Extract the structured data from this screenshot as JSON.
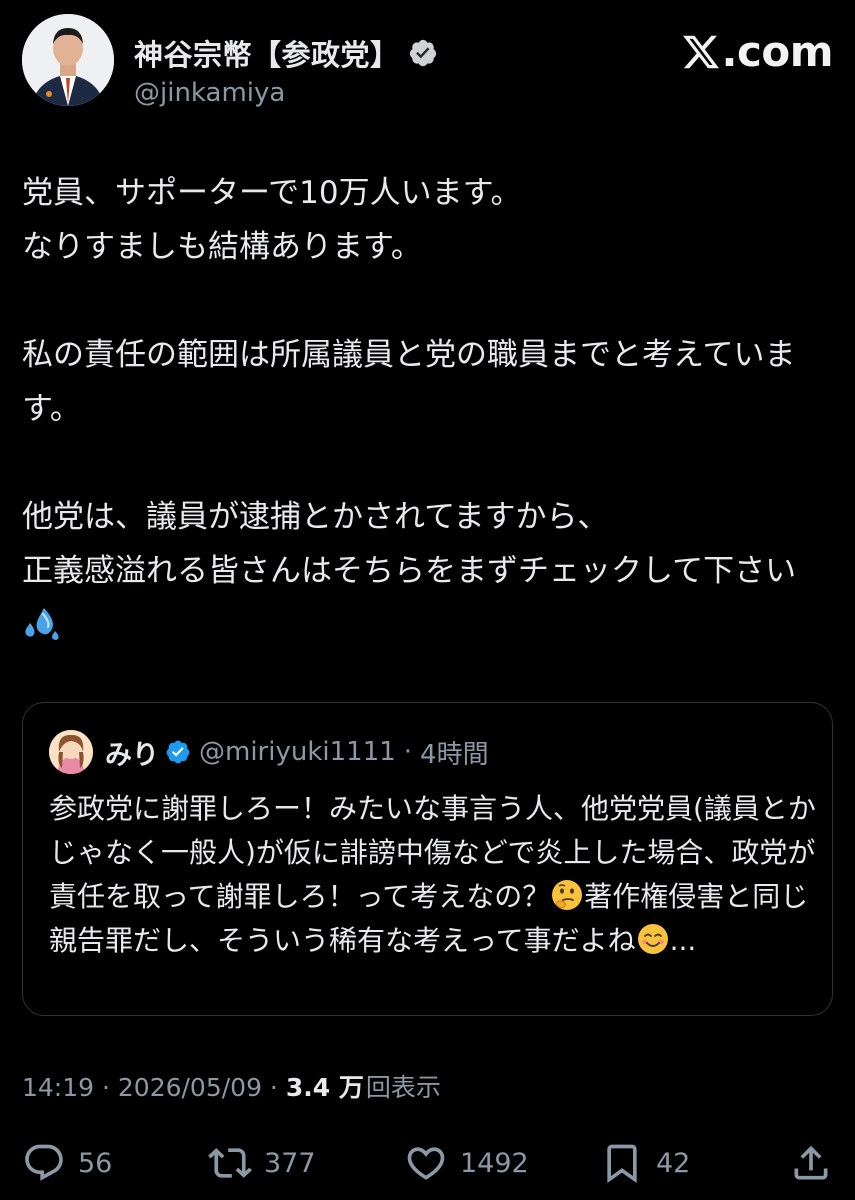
{
  "author": {
    "name": "神谷宗幣【参政党】",
    "handle": "@jinkamiya"
  },
  "brand": {
    "text": ".com",
    "accent": "#f2f2f2"
  },
  "post": {
    "lines": [
      "党員、サポーターで10万人います。",
      "なりすましも結構あります。",
      "",
      "私の責任の範囲は所属議員と党の職員までと考えています。",
      "",
      "他党は、議員が逮捕とかされてますから、",
      "正義感溢れる皆さんはそちらをまずチェックして下さい"
    ],
    "trailing_emoji": "sweat-droplets"
  },
  "quote": {
    "name": "みり",
    "handle": "@miriyuki1111",
    "time": "4時間",
    "text_part1": "参政党に謝罪しろー！みたいな事言う人、他党党員(議員とかじゃなく一般人)が仮に誹謗中傷などで炎上した場合、政党が責任を取って謝罪しろ！って考えなの？",
    "emoji1": "thinking-face",
    "text_part2": "著作権侵害と同じ親告罪だし、そういう稀有な考えって事だよね",
    "emoji2": "smiling-face",
    "text_tail": "..."
  },
  "meta": {
    "time": "14:19",
    "date": "2026/05/09",
    "views": "3.4 万",
    "views_label": "回表示"
  },
  "actions": {
    "replies": "56",
    "reposts": "377",
    "likes": "1492",
    "bookmarks": "42"
  },
  "colors": {
    "background": "#000000",
    "text": "#e7e9ea",
    "secondary": "#8b98a5",
    "verified": "#1d9bf0",
    "border": "#2f3336"
  }
}
